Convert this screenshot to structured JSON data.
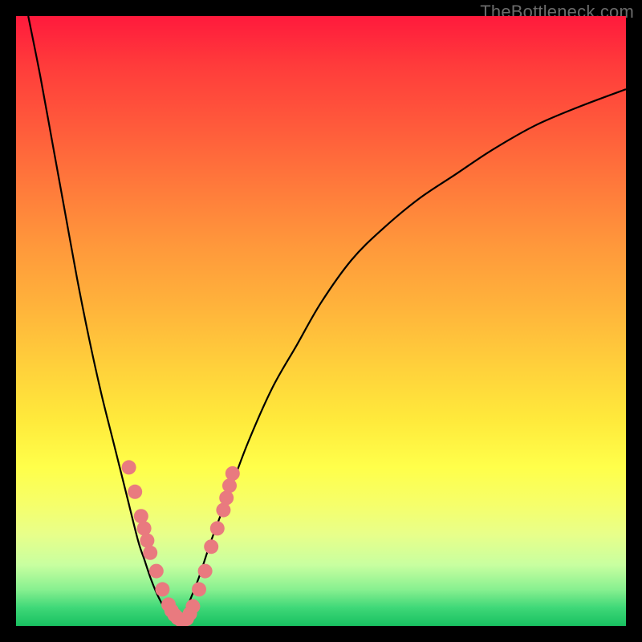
{
  "watermark": {
    "text": "TheBottleneck.com"
  },
  "chart_data": {
    "type": "line",
    "title": "",
    "xlabel": "",
    "ylabel": "",
    "xlim": [
      0,
      100
    ],
    "ylim": [
      0,
      100
    ],
    "grid": false,
    "legend": false,
    "series": [
      {
        "name": "left-branch",
        "x": [
          2,
          4,
          6,
          8,
          10,
          12,
          14,
          16,
          18,
          20,
          21,
          22,
          23,
          24,
          25,
          26
        ],
        "y": [
          100,
          90,
          79,
          68,
          57,
          47,
          38,
          30,
          22,
          14,
          11,
          8,
          5.5,
          3.5,
          2,
          1
        ]
      },
      {
        "name": "right-branch",
        "x": [
          27,
          28,
          30,
          32,
          35,
          38,
          42,
          46,
          50,
          55,
          60,
          66,
          72,
          78,
          85,
          92,
          100
        ],
        "y": [
          1,
          3,
          8,
          14,
          22,
          30,
          39,
          46,
          53,
          60,
          65,
          70,
          74,
          78,
          82,
          85,
          88
        ]
      }
    ],
    "scatter": {
      "name": "markers",
      "color": "#e97a7f",
      "points": [
        {
          "x": 18.5,
          "y": 26
        },
        {
          "x": 19.5,
          "y": 22
        },
        {
          "x": 20.5,
          "y": 18
        },
        {
          "x": 21,
          "y": 16
        },
        {
          "x": 21.5,
          "y": 14
        },
        {
          "x": 22,
          "y": 12
        },
        {
          "x": 23,
          "y": 9
        },
        {
          "x": 24,
          "y": 6
        },
        {
          "x": 25,
          "y": 3.5
        },
        {
          "x": 25.5,
          "y": 2.5
        },
        {
          "x": 26,
          "y": 1.8
        },
        {
          "x": 26.5,
          "y": 1.3
        },
        {
          "x": 27,
          "y": 1.0
        },
        {
          "x": 27.5,
          "y": 1.0
        },
        {
          "x": 28,
          "y": 1.2
        },
        {
          "x": 28.5,
          "y": 2
        },
        {
          "x": 29,
          "y": 3.2
        },
        {
          "x": 30,
          "y": 6
        },
        {
          "x": 31,
          "y": 9
        },
        {
          "x": 32,
          "y": 13
        },
        {
          "x": 33,
          "y": 16
        },
        {
          "x": 34,
          "y": 19
        },
        {
          "x": 34.5,
          "y": 21
        },
        {
          "x": 35,
          "y": 23
        },
        {
          "x": 35.5,
          "y": 25
        }
      ]
    },
    "background_gradient": {
      "top": "#ff1a3c",
      "mid": "#ffe93b",
      "bottom": "#18c060"
    }
  }
}
